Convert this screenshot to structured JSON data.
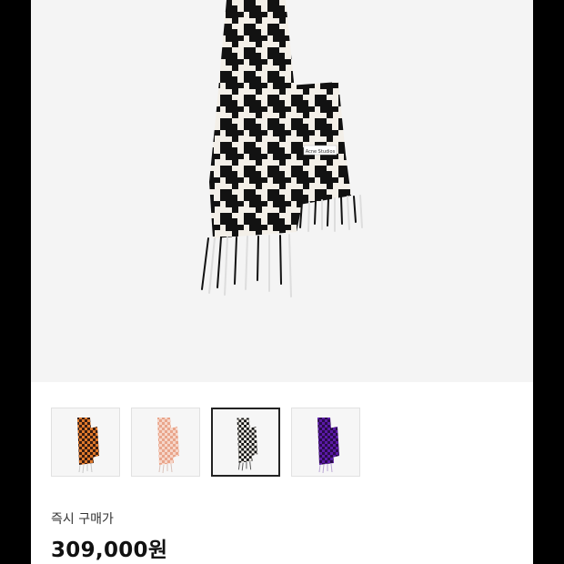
{
  "product": {
    "image_alt": "houndstooth fringed scarf",
    "tag_text": "Acne Studios"
  },
  "thumbnails": [
    {
      "name": "brown-orange",
      "primary": "#3a1d12",
      "secondary": "#e07a2c",
      "selected": false
    },
    {
      "name": "pink",
      "primary": "#e9a58b",
      "secondary": "#f6d6c9",
      "selected": false
    },
    {
      "name": "black-white",
      "primary": "#111111",
      "secondary": "#f2efe9",
      "selected": true
    },
    {
      "name": "purple",
      "primary": "#5b1aa8",
      "secondary": "#2a0b4a",
      "selected": false
    }
  ],
  "purchase": {
    "label": "즉시 구매가",
    "price": "309,000원"
  }
}
